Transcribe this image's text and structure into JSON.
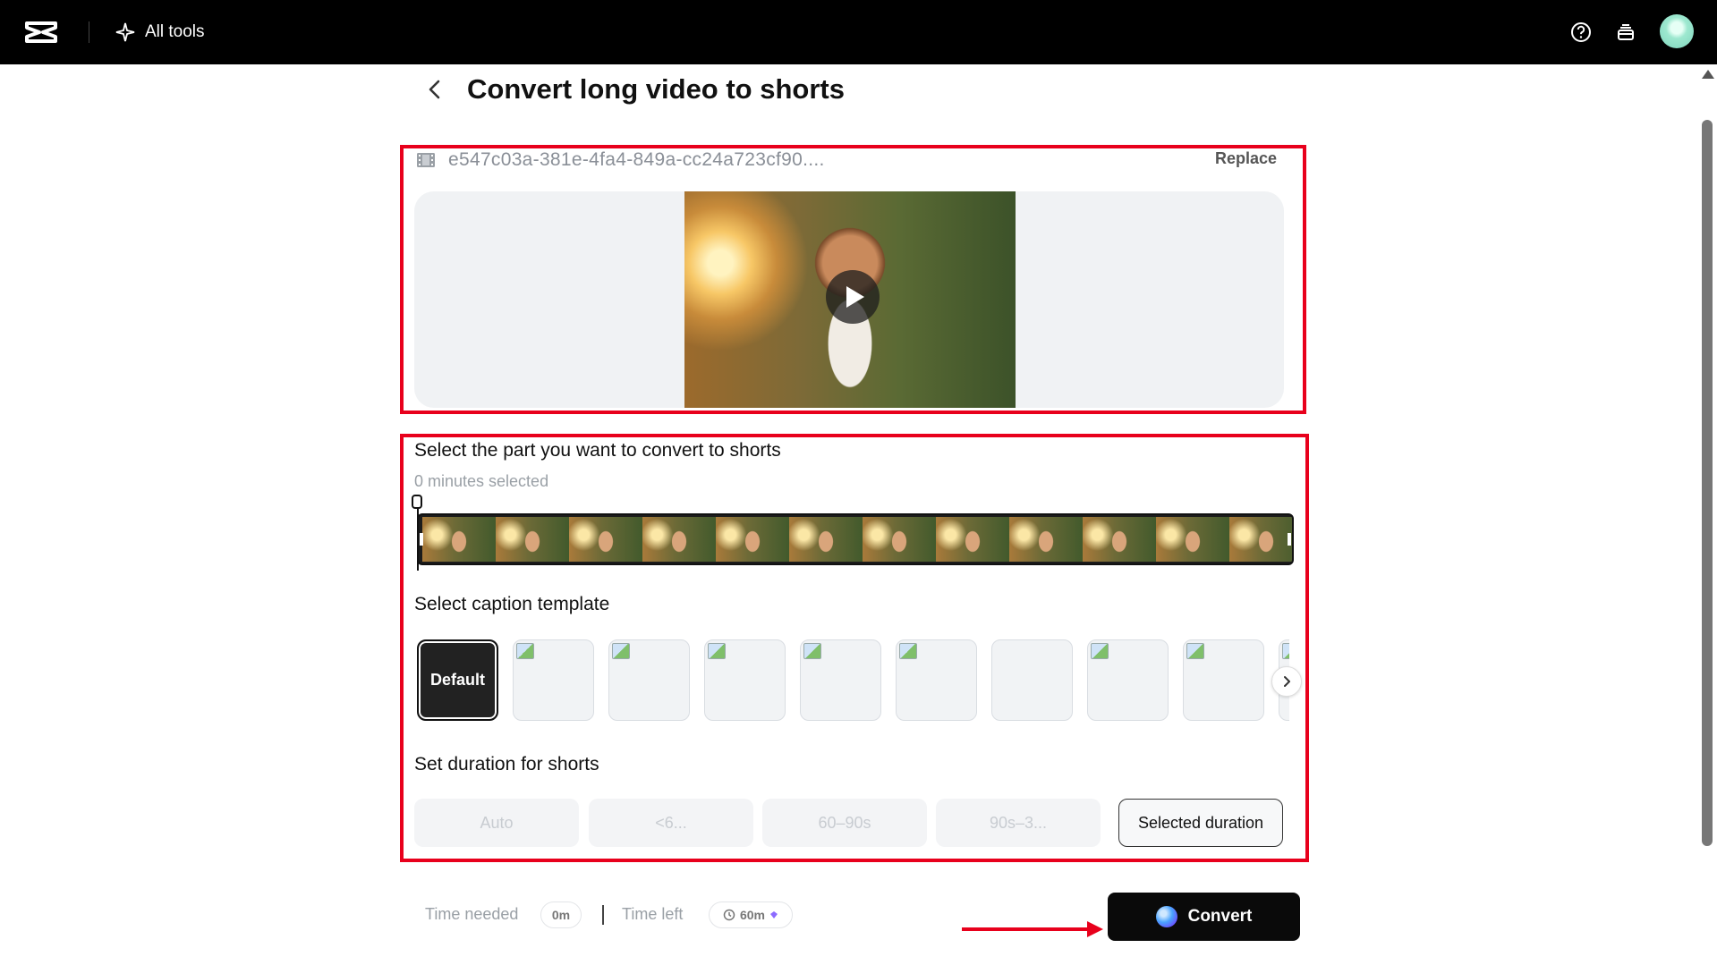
{
  "topbar": {
    "logo_icon": "capcut-logo-icon",
    "all_tools_label": "All tools",
    "help_icon": "help-circle-icon",
    "stack_icon": "stack-icon",
    "avatar_icon": "avatar"
  },
  "page": {
    "title": "Convert long video to shorts",
    "back_icon": "chevron-left-icon"
  },
  "upload": {
    "file_name": "e547c03a-381e-4fa4-849a-cc24a723cf90....",
    "replace_label": "Replace"
  },
  "selection": {
    "title": "Select the part you want to convert to shorts",
    "minutes_selected": "0 minutes selected"
  },
  "captions": {
    "title": "Select caption template",
    "default_label": "Default"
  },
  "duration": {
    "title": "Set duration for shorts",
    "options": [
      "Auto",
      "<6...",
      "60–90s",
      "90s–3...",
      "Selected duration"
    ],
    "selected": "Selected duration"
  },
  "footer": {
    "time_needed_label": "Time needed",
    "time_needed_value": "0m",
    "time_left_label": "Time left",
    "time_left_value": "60m",
    "convert_label": "Convert"
  },
  "colors": {
    "topbar": "#000000",
    "annotation_red": "#e8001c",
    "convert_button": "#0a0a0a"
  }
}
